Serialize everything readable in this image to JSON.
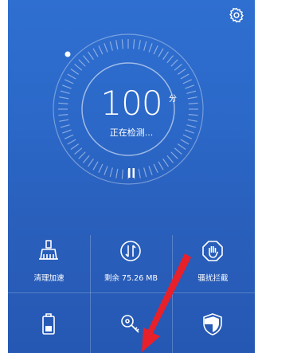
{
  "header": {
    "settings_icon": "gear-icon"
  },
  "dial": {
    "score": "100",
    "unit": "分",
    "status": "正在检测..."
  },
  "tools": [
    {
      "label": "清理加速",
      "icon": "broom-icon"
    },
    {
      "label": "剩余 75.26 MB",
      "icon": "data-transfer-icon"
    },
    {
      "label": "骚扰拦截",
      "icon": "hand-stop-icon"
    },
    {
      "label": "",
      "icon": "battery-icon"
    },
    {
      "label": "",
      "icon": "key-search-icon"
    },
    {
      "label": "",
      "icon": "shield-icon"
    }
  ],
  "colors": {
    "background": "#2b68c8",
    "annotation_arrow": "#e8202a"
  }
}
